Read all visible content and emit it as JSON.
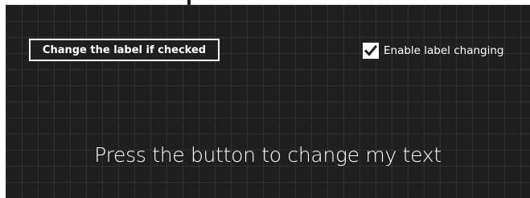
{
  "controls": {
    "change_button_label": "Change the label if checked",
    "checkbox_label": "Enable label changing",
    "checkbox_checked": true
  },
  "display": {
    "message": "Press the button to change my text"
  },
  "colors": {
    "background": "#1f1f1f",
    "foreground": "#ffffff",
    "page_border": "#ffffff"
  }
}
